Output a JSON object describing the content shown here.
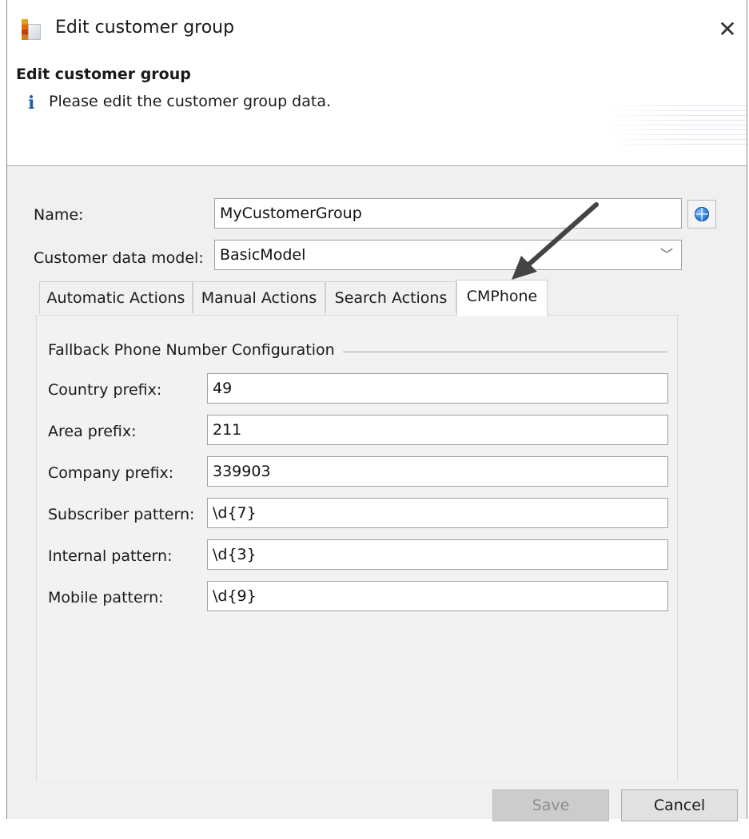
{
  "window": {
    "title": "Edit customer group",
    "close_glyph": "✕"
  },
  "banner": {
    "heading": "Edit customer group",
    "info_icon": "i",
    "message": "Please edit the customer group data."
  },
  "form": {
    "name_label": "Name:",
    "name_value": "MyCustomerGroup",
    "data_model_label": "Customer data model:",
    "data_model_value": "BasicModel",
    "dropdown_glyph": "﹀"
  },
  "tabs": [
    {
      "label": "Automatic Actions",
      "active": false
    },
    {
      "label": "Manual Actions",
      "active": false
    },
    {
      "label": "Search Actions",
      "active": false
    },
    {
      "label": "CMPhone",
      "active": true
    }
  ],
  "cmphone": {
    "group_title": "Fallback Phone Number Configuration",
    "fields": [
      {
        "label": "Country prefix:",
        "value": "49"
      },
      {
        "label": "Area prefix:",
        "value": "211"
      },
      {
        "label": "Company prefix:",
        "value": "339903"
      },
      {
        "label": "Subscriber pattern:",
        "value": "\\d{7}"
      },
      {
        "label": "Internal pattern:",
        "value": "\\d{3}"
      },
      {
        "label": "Mobile pattern:",
        "value": "\\d{9}"
      }
    ]
  },
  "buttons": {
    "save": "Save",
    "save_enabled": false,
    "cancel": "Cancel"
  },
  "icons": {
    "app": "app-logo-icon",
    "info": "info-icon",
    "globe": "globe-icon",
    "close": "close-icon",
    "annotation": "arrow-annotation"
  },
  "colors": {
    "info_blue": "#1f5fa8",
    "content_bg": "#f0f0f0",
    "arrow": "#444444"
  }
}
